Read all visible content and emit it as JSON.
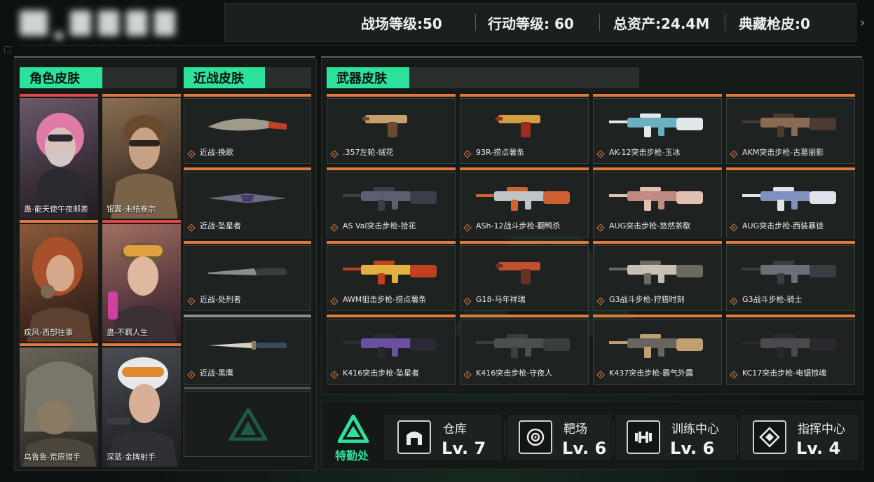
{
  "header": {
    "stats": [
      {
        "label": "战场等级",
        "sep": ":",
        "value": "50"
      },
      {
        "label": "行动等级",
        "sep": ": ",
        "value": "60"
      },
      {
        "label": "总资产",
        "sep": ":",
        "value": "24.4M"
      },
      {
        "label": "典藏枪皮",
        "sep": ":",
        "value": "0"
      }
    ]
  },
  "sections": {
    "character": "角色皮肤",
    "melee": "近战皮肤",
    "weapon": "武器皮肤"
  },
  "characters": [
    "蛊-能天使午夜邮差",
    "银翼-未结卷宗",
    "疾风-西部往事",
    "蛊-不羁人生",
    "乌鲁鲁-荒原猎手",
    "深蓝-金牌射手"
  ],
  "melee": [
    "近战-挽歌",
    "近战-坠星者",
    "近战-处刑者",
    "近战-黑鹰"
  ],
  "weapons": [
    ".357左轮-绒花",
    "93R-捞点薯条",
    "AK-12突击步枪-玉冰",
    "AKM突击步枪-古墓丽影",
    "AS Val突击步枪-拾花",
    "ASh-12战斗步枪-翻鸭杀",
    "AUG突击步枪-悠然茶歇",
    "AUG突击步枪-西装暴徒",
    "AWM狙击步枪-捞点薯条",
    "G18-马年祥瑞",
    "G3战斗步枪-狩猎时刻",
    "G3战斗步枪-骑士",
    "K416突击步枪-坠星者",
    "K416突击步枪-守夜人",
    "K437突击步枪-霸气外露",
    "KC17突击步枪-电锯惊魂"
  ],
  "hq": {
    "label": "特勤处",
    "facilities": [
      {
        "name": "仓库",
        "level": "Lv. 7",
        "icon": "warehouse-icon"
      },
      {
        "name": "靶场",
        "level": "Lv. 6",
        "icon": "target-icon"
      },
      {
        "name": "训练中心",
        "level": "Lv. 6",
        "icon": "dumbbell-icon"
      },
      {
        "name": "指挥中心",
        "level": "Lv. 4",
        "icon": "command-icon"
      }
    ]
  },
  "colors": {
    "accent": "#2de29a",
    "rarity_orange": "#e07a3a",
    "rarity_red": "#e04848"
  }
}
